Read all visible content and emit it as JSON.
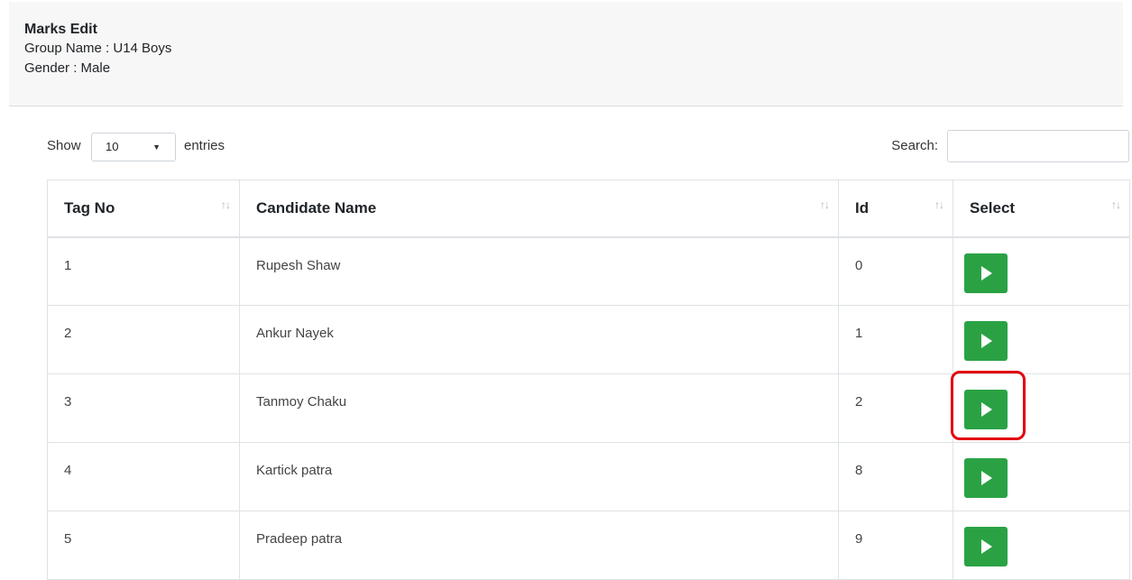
{
  "header": {
    "title": "Marks Edit",
    "group_name": "Group Name : U14 Boys",
    "gender": "Gender : Male"
  },
  "controls": {
    "show_label": "Show",
    "length_value": "10",
    "entries_label": "entries",
    "search_label": "Search:",
    "search_value": ""
  },
  "table": {
    "columns": [
      "Tag No",
      "Candidate Name",
      "Id",
      "Select"
    ],
    "sort_icon": "sort-arrows-icon",
    "rows": [
      {
        "tag_no": "1",
        "name": "Rupesh Shaw",
        "id": "0"
      },
      {
        "tag_no": "2",
        "name": "Ankur Nayek",
        "id": "1"
      },
      {
        "tag_no": "3",
        "name": "Tanmoy Chaku",
        "id": "2"
      },
      {
        "tag_no": "4",
        "name": "Kartick patra",
        "id": "8"
      },
      {
        "tag_no": "5",
        "name": "Pradeep patra",
        "id": "9"
      }
    ]
  },
  "colors": {
    "select_button": "#2aa244",
    "highlight": "#e3000f",
    "header_bg": "#f7f7f7"
  }
}
